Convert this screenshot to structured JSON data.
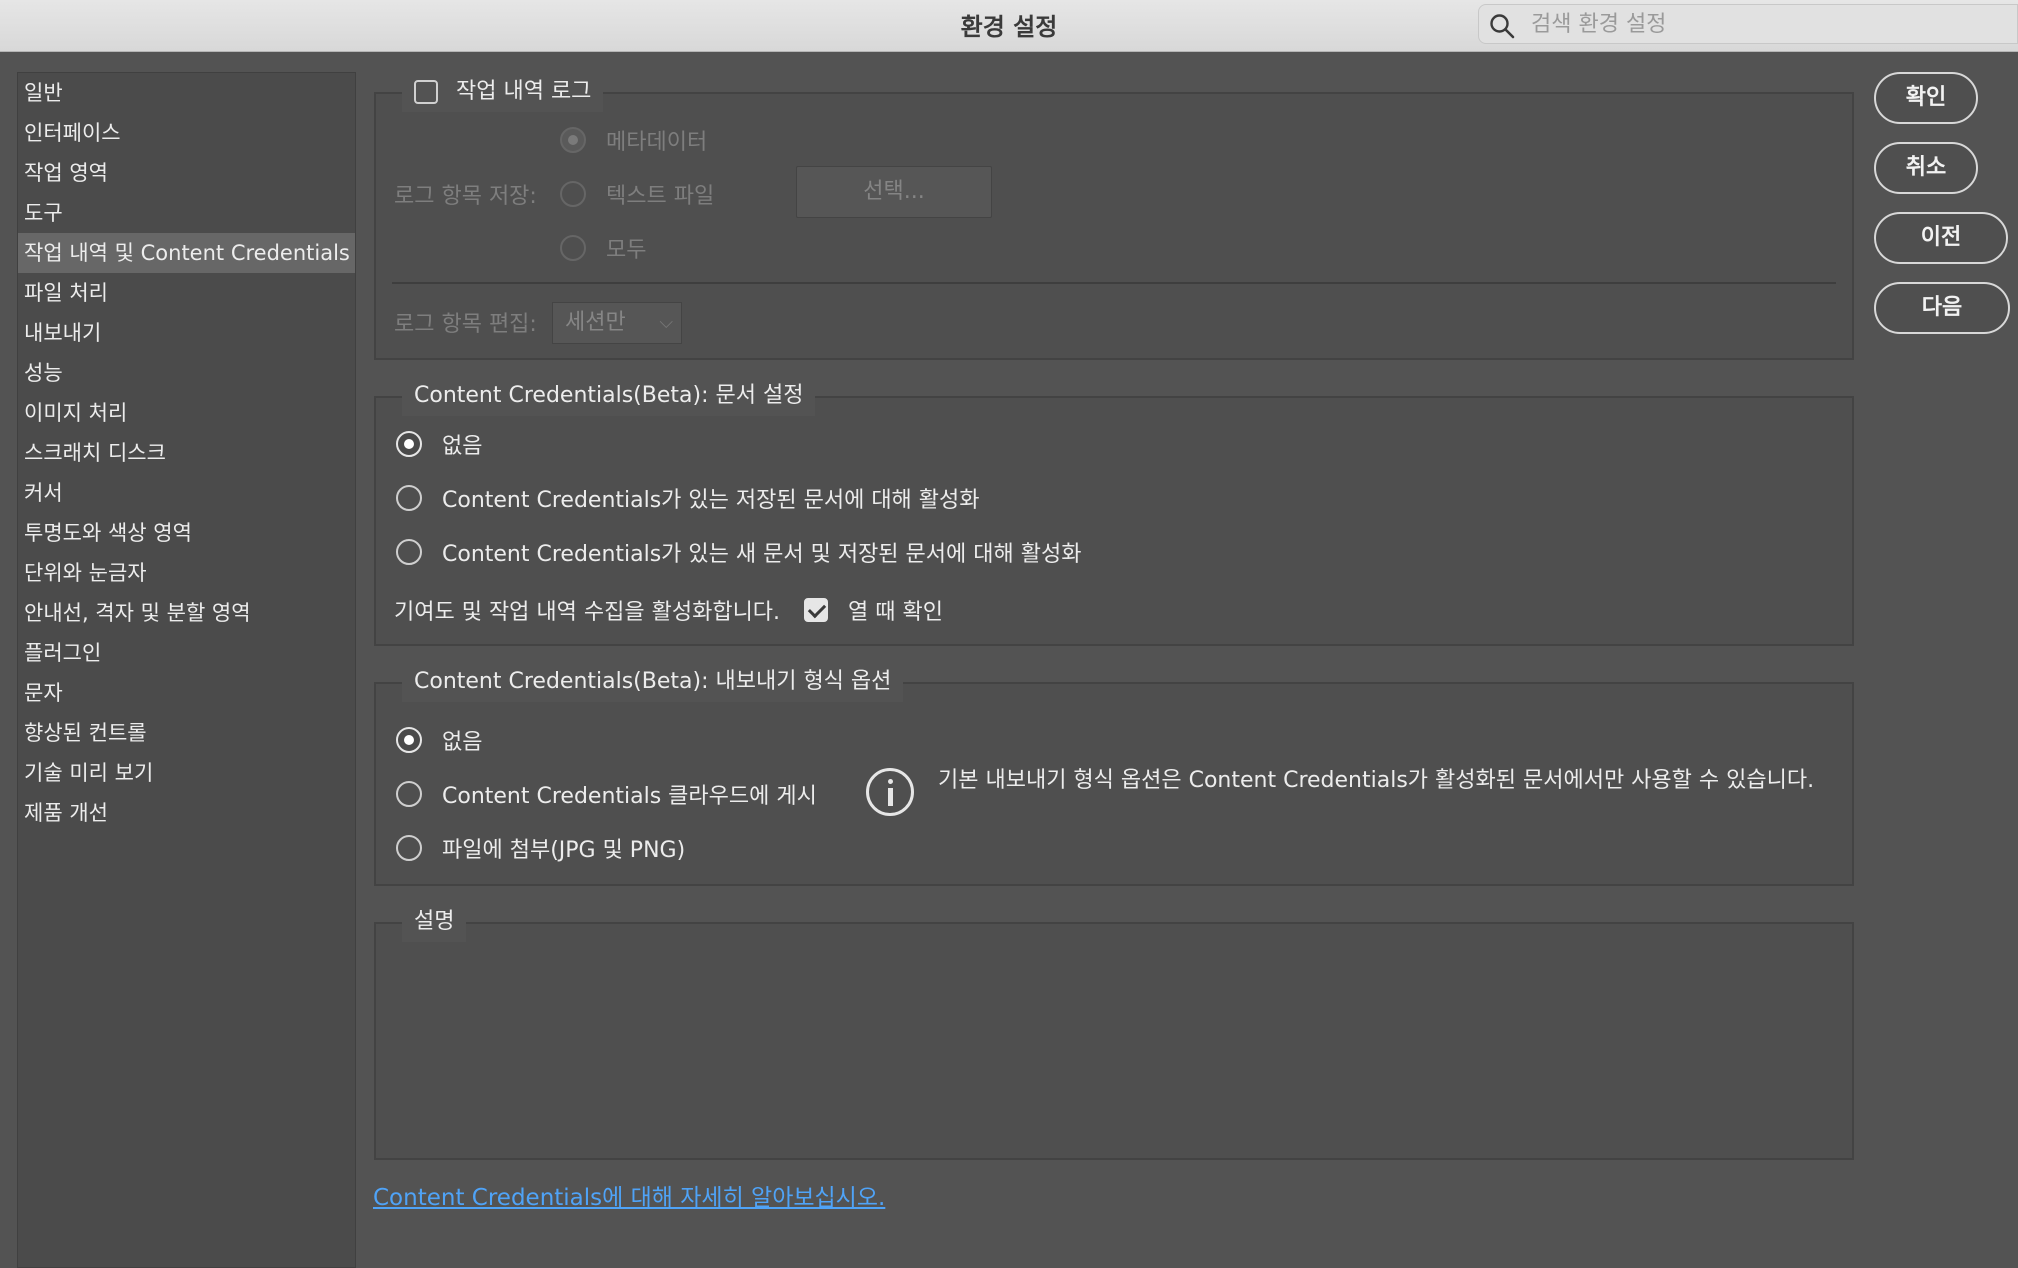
{
  "window": {
    "title": "환경 설정"
  },
  "search": {
    "placeholder": "검색 환경 설정"
  },
  "sidebar": {
    "items": [
      {
        "label": "일반"
      },
      {
        "label": "인터페이스"
      },
      {
        "label": "작업 영역"
      },
      {
        "label": "도구"
      },
      {
        "label": "작업 내역 및 Content Credentials",
        "selected": true
      },
      {
        "label": "파일 처리"
      },
      {
        "label": "내보내기"
      },
      {
        "label": "성능"
      },
      {
        "label": "이미지 처리"
      },
      {
        "label": "스크래치 디스크"
      },
      {
        "label": "커서"
      },
      {
        "label": "투명도와 색상 영역"
      },
      {
        "label": "단위와 눈금자"
      },
      {
        "label": "안내선, 격자 및 분할 영역"
      },
      {
        "label": "플러그인"
      },
      {
        "label": "문자"
      },
      {
        "label": "향상된 컨트롤"
      },
      {
        "label": "기술 미리 보기"
      },
      {
        "label": "제품 개선"
      }
    ]
  },
  "history_log": {
    "title": "작업 내역 로그",
    "enabled": false,
    "save_label": "로그 항목 저장:",
    "options": [
      "메타데이터",
      "텍스트 파일",
      "모두"
    ],
    "selected_option": "메타데이터",
    "choose_button": "선택...",
    "edit_label": "로그 항목 편집:",
    "edit_value": "세션만"
  },
  "doc_settings": {
    "title": "Content Credentials(Beta): 문서 설정",
    "options": [
      "없음",
      "Content Credentials가 있는 저장된 문서에 대해 활성화",
      "Content Credentials가 있는 새 문서 및 저장된 문서에 대해 활성화"
    ],
    "selected_option": "없음",
    "collect_text": "기여도 및 작업 내역 수집을 활성화합니다.",
    "confirm_on_open_label": "열 때 확인",
    "confirm_on_open_checked": true
  },
  "export_options": {
    "title": "Content Credentials(Beta): 내보내기 형식 옵션",
    "options": [
      "없음",
      "Content Credentials 클라우드에 게시",
      "파일에 첨부(JPG 및 PNG)"
    ],
    "selected_option": "없음",
    "info_text": "기본 내보내기 형식 옵션은 Content Credentials가 활성화된 문서에서만 사용할 수 있습니다."
  },
  "description": {
    "title": "설명"
  },
  "learn_more_link": "Content Credentials에 대해 자세히 알아보십시오.",
  "buttons": {
    "ok": "확인",
    "cancel": "취소",
    "prev": "이전",
    "next": "다음"
  }
}
